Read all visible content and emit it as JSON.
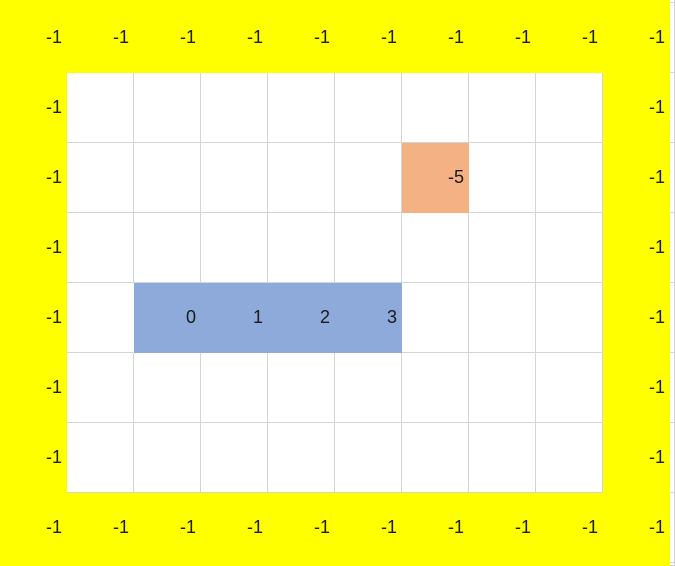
{
  "colors": {
    "border_fill": "#ffff00",
    "snake_fill": "#8eaadb",
    "hazard_fill": "#f4b183",
    "gridline": "#d4d4d4"
  },
  "grid": {
    "rows": [
      [
        "-1",
        "-1",
        "-1",
        "-1",
        "-1",
        "-1",
        "-1",
        "-1",
        "-1",
        "-1"
      ],
      [
        "-1",
        "",
        "",
        "",
        "",
        "",
        "",
        "",
        "",
        "-1"
      ],
      [
        "-1",
        "",
        "",
        "",
        "",
        "",
        "-5",
        "",
        "",
        "-1"
      ],
      [
        "-1",
        "",
        "",
        "",
        "",
        "",
        "",
        "",
        "",
        "-1"
      ],
      [
        "-1",
        "",
        "0",
        "1",
        "2",
        "3",
        "",
        "",
        "",
        "-1"
      ],
      [
        "-1",
        "",
        "",
        "",
        "",
        "",
        "",
        "",
        "",
        "-1"
      ],
      [
        "-1",
        "",
        "",
        "",
        "",
        "",
        "",
        "",
        "",
        "-1"
      ],
      [
        "-1",
        "-1",
        "-1",
        "-1",
        "-1",
        "-1",
        "-1",
        "-1",
        "-1",
        "-1"
      ]
    ],
    "styles": [
      [
        "border",
        "border",
        "border",
        "border",
        "border",
        "border",
        "border",
        "border",
        "border",
        "border"
      ],
      [
        "border",
        "",
        "",
        "",
        "",
        "",
        "",
        "",
        "",
        "border"
      ],
      [
        "border",
        "",
        "",
        "",
        "",
        "",
        "orange",
        "",
        "",
        "border"
      ],
      [
        "border",
        "",
        "",
        "",
        "",
        "",
        "",
        "",
        "",
        "border"
      ],
      [
        "border",
        "noright",
        "blue",
        "blue",
        "blue",
        "blue",
        "",
        "",
        "",
        "border"
      ],
      [
        "border",
        "",
        "",
        "",
        "",
        "",
        "",
        "",
        "",
        "border"
      ],
      [
        "border",
        "",
        "",
        "",
        "",
        "",
        "",
        "",
        "",
        "border"
      ],
      [
        "border",
        "border",
        "border",
        "border",
        "border",
        "border",
        "border",
        "border",
        "border",
        "border"
      ]
    ]
  }
}
